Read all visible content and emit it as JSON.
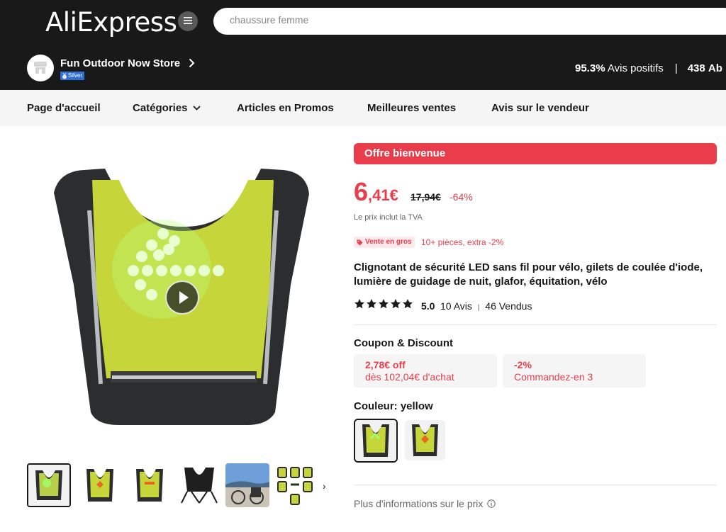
{
  "header": {
    "logo": "AliExpress",
    "search_placeholder": "chaussure femme"
  },
  "store": {
    "name": "Fun Outdoor Now Store",
    "badge": "Silver",
    "positive_pct": "95.3%",
    "positive_label": "Avis positifs",
    "sep": "|",
    "followers": "438",
    "followers_label": "Ab"
  },
  "nav": {
    "home": "Page d'accueil",
    "categories": "Catégories",
    "promos": "Articles en Promos",
    "best": "Meilleures ventes",
    "reviews": "Avis sur le vendeur"
  },
  "product": {
    "offer_label": "Offre bienvenue",
    "price_int": "6",
    "price_dec": ",41€",
    "old_price": "17,94€",
    "discount": "-64%",
    "tva": "Le prix inclut la TVA",
    "bulk_label": "Vente en gros",
    "bulk_text": "10+ pièces, extra -2%",
    "title": "Clignotant de sécurité LED sans fil pour vélo, gilets de coulée d'iode, lumière de guidage de nuit, glafor, équitation, vélo",
    "rating": "5.0",
    "reviews_count": "10 Avis",
    "reviews_sep": "|",
    "sold": "46 Vendus",
    "stars": 5
  },
  "coupons": {
    "title": "Coupon & Discount",
    "items": [
      {
        "line1": "2,78€ off",
        "line2": "dès 102,04€ d'achat"
      },
      {
        "line1": "-2%",
        "line2": "Commandez-en 3"
      }
    ]
  },
  "color": {
    "label": "Couleur: yellow",
    "options": [
      "yellow",
      "red"
    ],
    "selected": "yellow"
  },
  "more_info": "Plus d'informations sur le prix",
  "colors": {
    "accent": "#e93d4b",
    "header_bg": "#191919",
    "nav_bg": "#f5f5f5",
    "vest_green": "#c6d63a"
  },
  "icons": {
    "menu": "menu-icon",
    "chevron_right": "chevron-right-icon",
    "chevron_down": "chevron-down-icon",
    "play": "play-icon",
    "star": "star-icon",
    "info": "info-icon",
    "tag": "tag-icon",
    "medal": "medal-icon"
  }
}
